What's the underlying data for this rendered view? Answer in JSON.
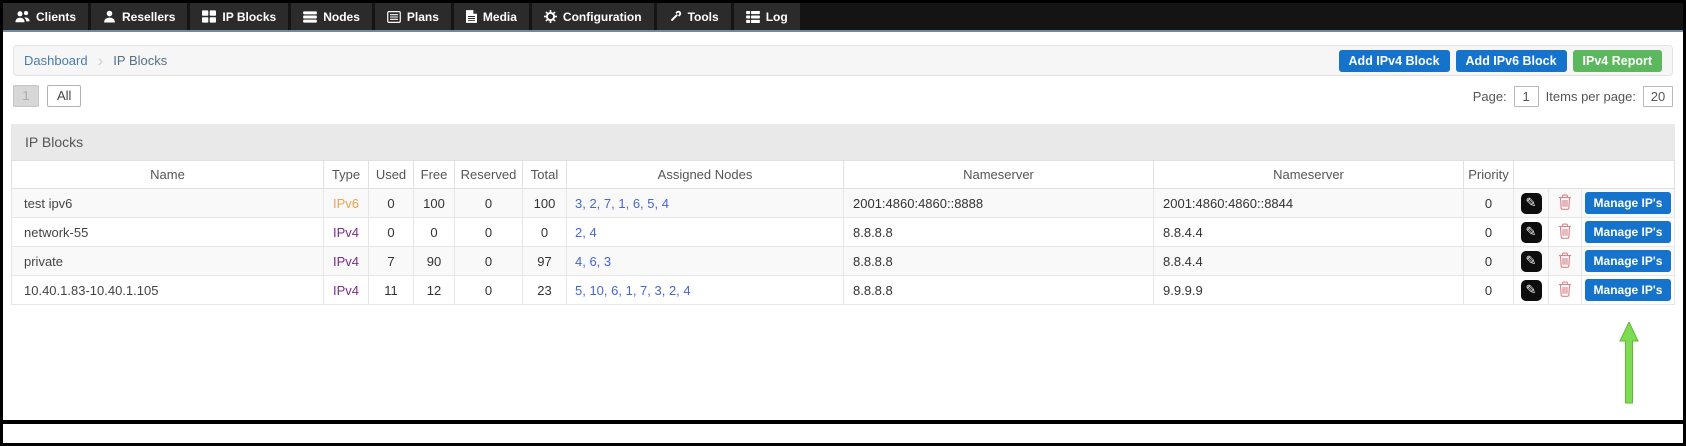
{
  "nav": {
    "items": [
      {
        "label": "Clients",
        "icon": "users-icon"
      },
      {
        "label": "Resellers",
        "icon": "user-icon"
      },
      {
        "label": "IP Blocks",
        "icon": "grid-icon"
      },
      {
        "label": "Nodes",
        "icon": "server-icon"
      },
      {
        "label": "Plans",
        "icon": "list-icon"
      },
      {
        "label": "Media",
        "icon": "file-icon"
      },
      {
        "label": "Configuration",
        "icon": "gear-icon"
      },
      {
        "label": "Tools",
        "icon": "wrench-icon"
      },
      {
        "label": "Log",
        "icon": "table-icon"
      }
    ]
  },
  "breadcrumb": {
    "link": "Dashboard",
    "current": "IP Blocks"
  },
  "header_buttons": {
    "add_ipv4": "Add IPv4 Block",
    "add_ipv6": "Add IPv6 Block",
    "ipv4_report": "IPv4 Report"
  },
  "pagination": {
    "page_button": "1",
    "all_button": "All",
    "page_label": "Page:",
    "page_value": "1",
    "items_per_page_label": "Items per page:",
    "items_per_page_value": "20"
  },
  "panel": {
    "title": "IP Blocks"
  },
  "table": {
    "headers": [
      "Name",
      "Type",
      "Used",
      "Free",
      "Reserved",
      "Total",
      "Assigned Nodes",
      "Nameserver",
      "Nameserver",
      "Priority"
    ],
    "manage_label": "Manage IP's",
    "edit_icon": "✎",
    "rows": [
      {
        "name": "test ipv6",
        "type": "IPv6",
        "used": "0",
        "free": "100",
        "reserved": "0",
        "total": "100",
        "assigned_nodes": "3, 2, 7, 1, 6, 5, 4",
        "nameserver1": "2001:4860:4860::8888",
        "nameserver2": "2001:4860:4860::8844",
        "priority": "0"
      },
      {
        "name": "network-55",
        "type": "IPv4",
        "used": "0",
        "free": "0",
        "reserved": "0",
        "total": "0",
        "assigned_nodes": "2, 4",
        "nameserver1": "8.8.8.8",
        "nameserver2": "8.8.4.4",
        "priority": "0"
      },
      {
        "name": "private",
        "type": "IPv4",
        "used": "7",
        "free": "90",
        "reserved": "0",
        "total": "97",
        "assigned_nodes": "4, 6, 3",
        "nameserver1": "8.8.8.8",
        "nameserver2": "8.8.4.4",
        "priority": "0"
      },
      {
        "name": "10.40.1.83-10.40.1.105",
        "type": "IPv4",
        "used": "11",
        "free": "12",
        "reserved": "0",
        "total": "23",
        "assigned_nodes": "5, 10, 6, 1, 7, 3, 2, 4",
        "nameserver1": "8.8.8.8",
        "nameserver2": "9.9.9.9",
        "priority": "0"
      }
    ]
  },
  "colors": {
    "primary_button": "#1673cb",
    "success_button": "#5cb85c",
    "ipv6_type": "#f0a150",
    "ipv4_type": "#7b2c8c",
    "node_link": "#4666d1",
    "trash_icon": "#d9838c",
    "arrow_green": "#7edc53",
    "nav_underline": "#6d8ca4"
  }
}
